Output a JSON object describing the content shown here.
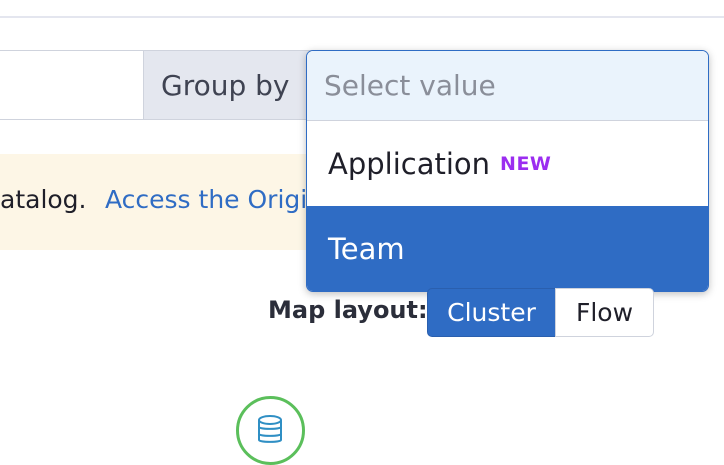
{
  "toolbar": {
    "group_by_label": "Group by"
  },
  "dropdown": {
    "placeholder": "Select value",
    "options": [
      {
        "label": "Application",
        "badge": "NEW",
        "selected": false
      },
      {
        "label": "Team",
        "badge": "",
        "selected": true
      }
    ]
  },
  "banner": {
    "text": "atalog.",
    "link": "Access the Original"
  },
  "map_layout": {
    "label": "Map layout:",
    "options": [
      "Cluster",
      "Flow"
    ],
    "selected": "Cluster"
  },
  "colors": {
    "accent": "#2f6cc4",
    "badge_new": "#9b2df0",
    "banner_bg": "#fdf6e6",
    "node_ok": "#5bbf5b"
  },
  "icons": {
    "db_node": "database-icon"
  }
}
